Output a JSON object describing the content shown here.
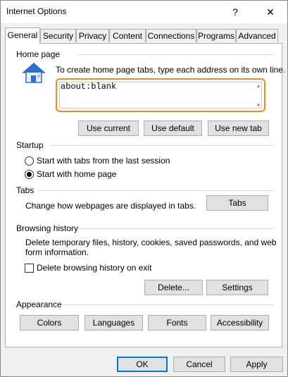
{
  "window": {
    "title": "Internet Options",
    "help_glyph": "?",
    "close_glyph": "✕"
  },
  "tabs": [
    {
      "label": "General"
    },
    {
      "label": "Security"
    },
    {
      "label": "Privacy"
    },
    {
      "label": "Content"
    },
    {
      "label": "Connections"
    },
    {
      "label": "Programs"
    },
    {
      "label": "Advanced"
    }
  ],
  "home_page": {
    "label": "Home page",
    "instruction": "To create home page tabs, type each address on its own line.",
    "value": "about:blank",
    "buttons": {
      "use_current": "Use current",
      "use_default": "Use default",
      "use_new_tab": "Use new tab"
    }
  },
  "startup": {
    "label": "Startup",
    "option_last_session": "Start with tabs from the last session",
    "option_home_page": "Start with home page",
    "selected": "home_page"
  },
  "tabs_section": {
    "label": "Tabs",
    "description": "Change how webpages are displayed in tabs.",
    "button": "Tabs"
  },
  "browsing_history": {
    "label": "Browsing history",
    "description_line1": "Delete temporary files, history, cookies, saved passwords, and web",
    "description_line2": "form information.",
    "delete_on_exit": "Delete browsing history on exit",
    "delete_on_exit_checked": false,
    "delete_button": "Delete...",
    "settings_button": "Settings"
  },
  "appearance": {
    "label": "Appearance",
    "buttons": {
      "colors": "Colors",
      "languages": "Languages",
      "fonts": "Fonts",
      "accessibility": "Accessibility"
    }
  },
  "footer": {
    "ok": "OK",
    "cancel": "Cancel",
    "apply": "Apply"
  },
  "colors": {
    "focus_outline": "#f08a24",
    "default_button_border": "#0078d7",
    "house_icon": "#2f6fc9"
  }
}
